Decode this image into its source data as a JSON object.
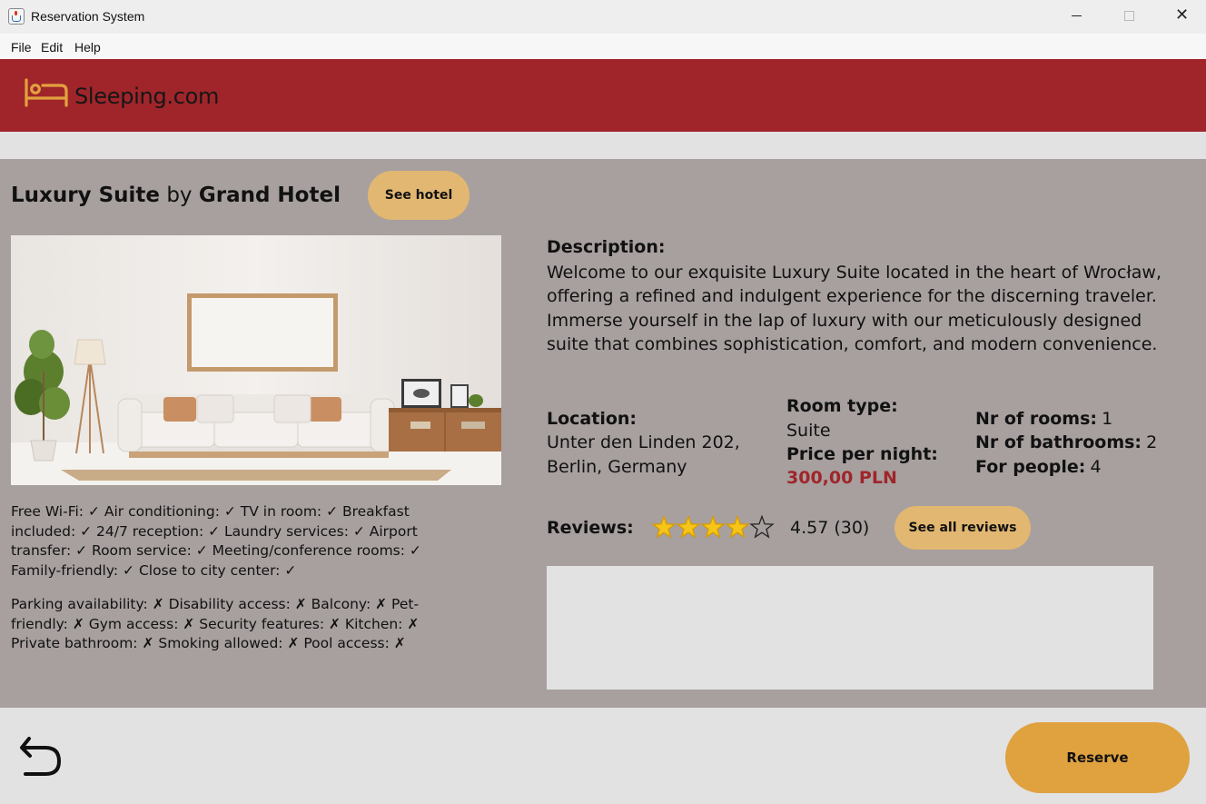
{
  "window": {
    "title": "Reservation System",
    "close_glyph": "✕"
  },
  "menu": [
    "File",
    "Edit",
    "Help"
  ],
  "header": {
    "logo_text": "Sleeping.com",
    "brand_color": "#a0252a",
    "logo_icon": "bed-icon"
  },
  "room": {
    "name": "Luxury Suite",
    "by": "by",
    "hotel": "Grand Hotel",
    "see_hotel_label": "See hotel",
    "photo_icon": "living-room-photo"
  },
  "amenities": {
    "available": "Free Wi-Fi: ✓ Air conditioning: ✓ TV in room: ✓ Breakfast included: ✓ 24/7 reception: ✓ Laundry services: ✓ Airport transfer: ✓ Room service: ✓ Meeting/conference rooms: ✓ Family-friendly: ✓ Close to city center: ✓",
    "unavailable": "Parking availability: ✗ Disability access: ✗ Balcony: ✗ Pet-friendly: ✗ Gym access: ✗ Security features: ✗ Kitchen: ✗ Private bathroom: ✗ Smoking allowed: ✗ Pool access: ✗"
  },
  "description": {
    "label": "Description:",
    "text": "Welcome to our exquisite Luxury Suite located in the heart of Wrocław, offering a refined and indulgent experience for the discerning traveler. Immerse yourself in the lap of luxury with our meticulously designed suite that combines sophistication, comfort, and modern convenience."
  },
  "details": {
    "location_label": "Location:",
    "location_line1": "Unter den Linden 202,",
    "location_line2": "Berlin, Germany",
    "room_type_label": "Room type:",
    "room_type": "Suite",
    "price_label": "Price per night:",
    "price": "300,00 PLN",
    "price_color": "#a0252a",
    "rooms_label": "Nr of rooms:",
    "rooms": "1",
    "bathrooms_label": "Nr of bathrooms:",
    "bathrooms": "2",
    "people_label": "For people:",
    "people": "4"
  },
  "reviews": {
    "label": "Reviews:",
    "stars_filled": 4,
    "stars_total": 5,
    "score_text": "4.57 (30)",
    "see_all_label": "See all reviews"
  },
  "footer": {
    "back_icon": "back-arrow-icon",
    "reserve_label": "Reserve"
  }
}
